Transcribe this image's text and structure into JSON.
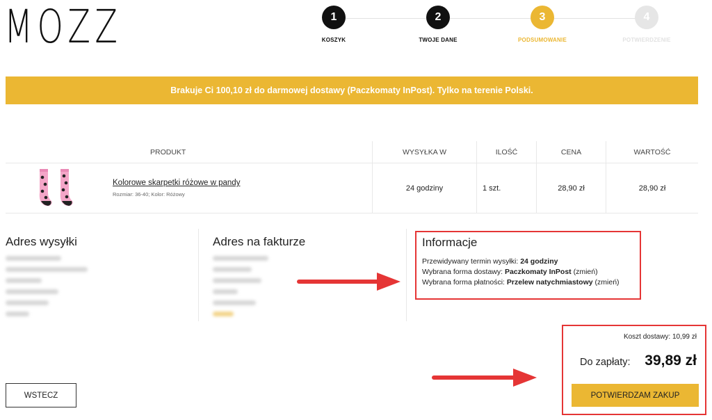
{
  "brand": {
    "logo": "MOZZ"
  },
  "steps": [
    {
      "number": "1",
      "label": "KOSZYK",
      "state": "done"
    },
    {
      "number": "2",
      "label": "TWOJE DANE",
      "state": "done"
    },
    {
      "number": "3",
      "label": "PODSUMOWANIE",
      "state": "active"
    },
    {
      "number": "4",
      "label": "POTWIERDZENIE",
      "state": "todo"
    }
  ],
  "colors": {
    "accent": "#ebb733",
    "done": "#111111",
    "todo": "#e6e6e6",
    "highlight": "#e53535"
  },
  "banner": {
    "text": "Brakuje Ci 100,10 zł do darmowej dostawy (Paczkomaty InPost). Tylko na terenie Polski."
  },
  "table": {
    "headers": {
      "product": "PRODUKT",
      "shipping": "WYSYŁKA W",
      "qty": "ILOŚĆ",
      "price": "CENA",
      "total": "WARTOŚĆ"
    },
    "rows": [
      {
        "name": "Kolorowe skarpetki różowe w pandy",
        "meta": "Rozmiar: 36-40; Kolor: Różowy",
        "shipping": "24 godziny",
        "qty": "1 szt.",
        "price": "28,90 zł",
        "total": "28,90 zł",
        "image_icon": "pink-panda-socks-image"
      }
    ]
  },
  "shipping_address": {
    "title": "Adres wysyłki"
  },
  "invoice_address": {
    "title": "Adres na fakturze"
  },
  "info": {
    "title": "Informacje",
    "delivery_time_label": "Przewidywany termin wysyłki:",
    "delivery_time_value": "24 godziny",
    "delivery_method_label": "Wybrana forma dostawy:",
    "delivery_method_value": "Paczkomaty InPost",
    "payment_method_label": "Wybrana forma płatności:",
    "payment_method_value": "Przelew natychmiastowy",
    "change_link": "(zmień)"
  },
  "summary": {
    "shipping_cost": "Koszt dostawy: 10,99 zł",
    "total_label": "Do zapłaty:",
    "total_value": "39,89 zł",
    "confirm_button": "POTWIERDZAM ZAKUP"
  },
  "back_button": "WSTECZ"
}
